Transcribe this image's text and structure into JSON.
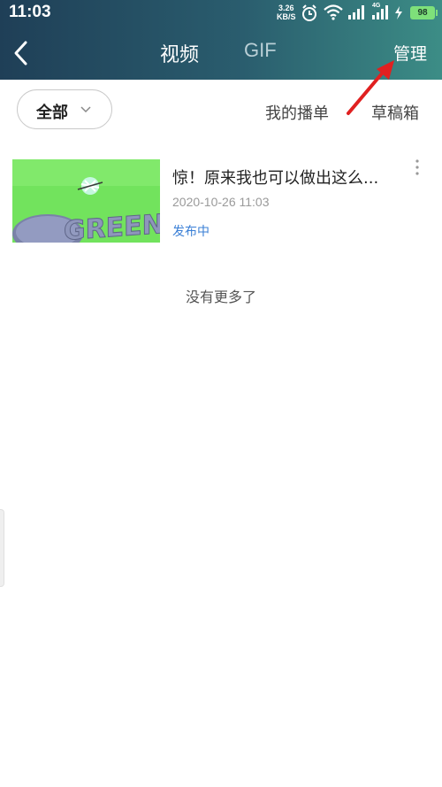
{
  "status_bar": {
    "time": "11:03",
    "net_speed_value": "3.26",
    "net_speed_unit": "KB/S",
    "network_type": "4G",
    "battery": "98"
  },
  "nav": {
    "tabs": [
      {
        "label": "视频",
        "active": true
      },
      {
        "label": "GIF",
        "active": false
      }
    ],
    "manage_label": "管理"
  },
  "filter": {
    "selected": "全部",
    "links": [
      "我的播单",
      "草稿箱"
    ]
  },
  "videos": [
    {
      "title": "惊！原来我也可以做出这么...",
      "date": "2020-10-26 11:03",
      "status": "发布中",
      "thumbnail_text": "GREEN"
    }
  ],
  "footer_text": "没有更多了",
  "colors": {
    "header_gradient_start": "#1f3f57",
    "header_gradient_end": "#3c8d86",
    "status_link": "#3a7fd6",
    "annotation_arrow": "#e02020"
  }
}
